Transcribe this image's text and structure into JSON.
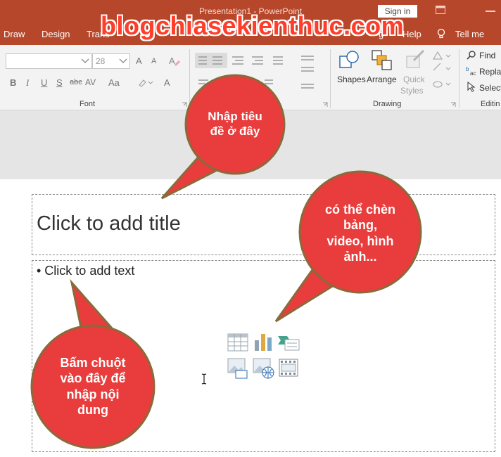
{
  "window": {
    "title": "Presentation1  -  PowerPoint",
    "sign_in": "Sign in"
  },
  "tabs": [
    {
      "label": "Draw"
    },
    {
      "label": "Design"
    },
    {
      "label": "Trans"
    },
    {
      "label": "g"
    },
    {
      "label": "Help"
    },
    {
      "label": "Tell me"
    }
  ],
  "watermark": "blogchiasekienthuc.com",
  "ribbon": {
    "font_size": "28",
    "groups": {
      "font": "Font",
      "drawing": "Drawing",
      "editing": "Editin"
    },
    "font_buttons": [
      "B",
      "I",
      "U",
      "S",
      "abc",
      "AV",
      "Aa",
      "A"
    ],
    "grow_font": "A",
    "shrink_font": "A",
    "shapes": "Shapes",
    "arrange": "Arrange",
    "quick_styles": [
      "Quick",
      "Styles"
    ],
    "find": "Find",
    "replace": "Repla",
    "select": "Select"
  },
  "slide": {
    "title_placeholder": "Click to add title",
    "content_placeholder": "• Click to add text"
  },
  "callouts": {
    "title_hint": [
      "Nhập tiêu",
      "đề ở đây"
    ],
    "insert_hint": [
      "có thể chèn",
      "bảng,",
      "video, hình",
      "ảnh..."
    ],
    "content_hint": [
      "Bấm chuột",
      "vào đây để",
      "nhập nội",
      "dung"
    ]
  },
  "colors": {
    "accent": "#b7472a",
    "callout_fill": "#e93c3c",
    "callout_border": "#8a6a3a"
  }
}
